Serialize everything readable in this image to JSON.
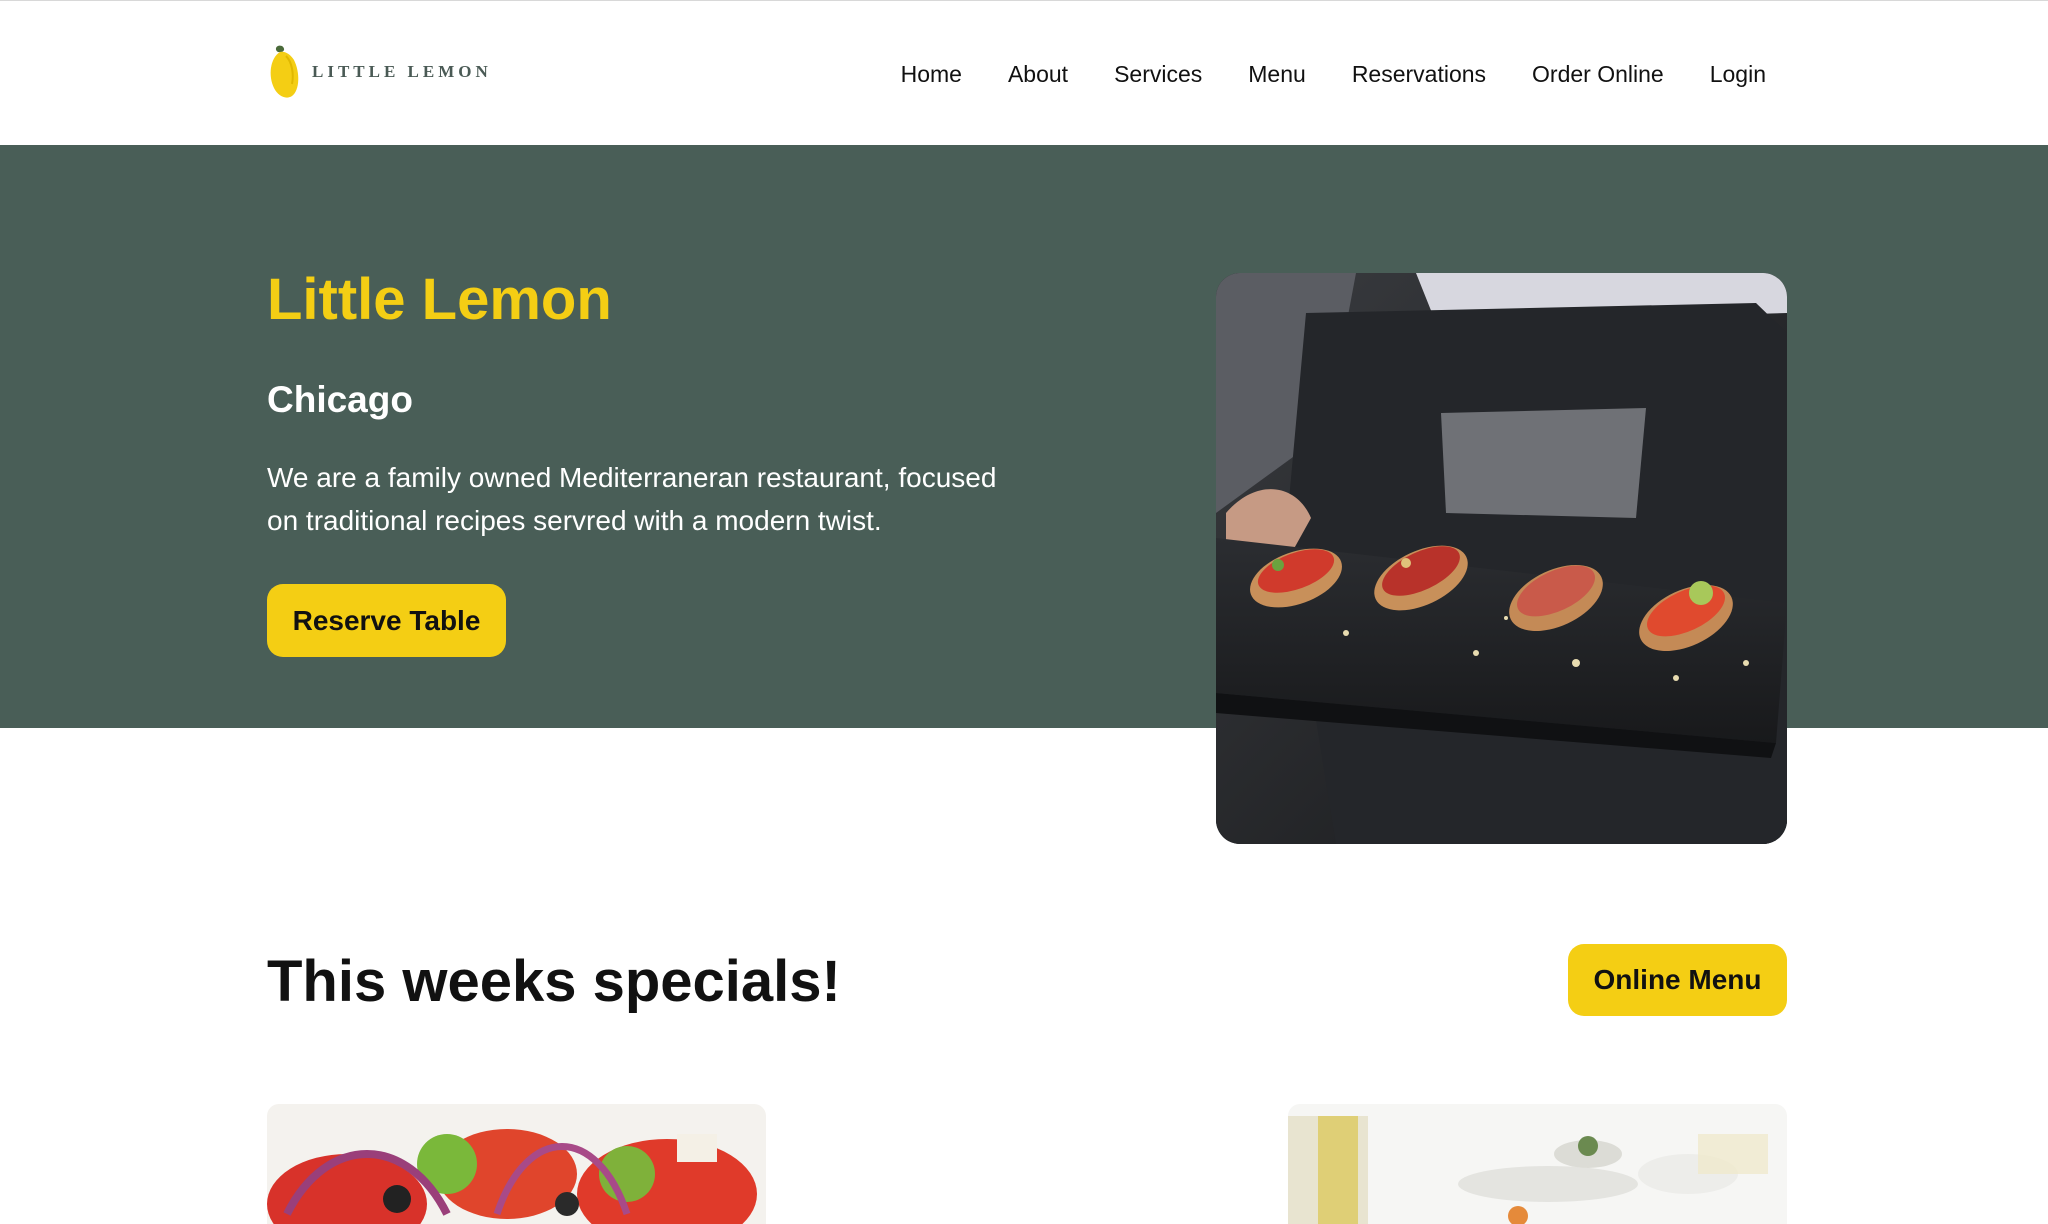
{
  "brand": {
    "logo_text": "LITTLE LEMON",
    "primary_green": "#495e57",
    "primary_yellow": "#f4ce14"
  },
  "nav": {
    "items": [
      {
        "label": "Home"
      },
      {
        "label": "About"
      },
      {
        "label": "Services"
      },
      {
        "label": "Menu"
      },
      {
        "label": "Reservations"
      },
      {
        "label": "Order Online"
      },
      {
        "label": "Login"
      }
    ]
  },
  "hero": {
    "title": "Little Lemon",
    "subtitle": "Chicago",
    "description": "We are a family owned Mediterraneran restaurant, focused on traditional recipes servred with a modern twist.",
    "cta_label": "Reserve Table"
  },
  "specials": {
    "title": "This weeks specials!",
    "menu_button_label": "Online Menu"
  }
}
